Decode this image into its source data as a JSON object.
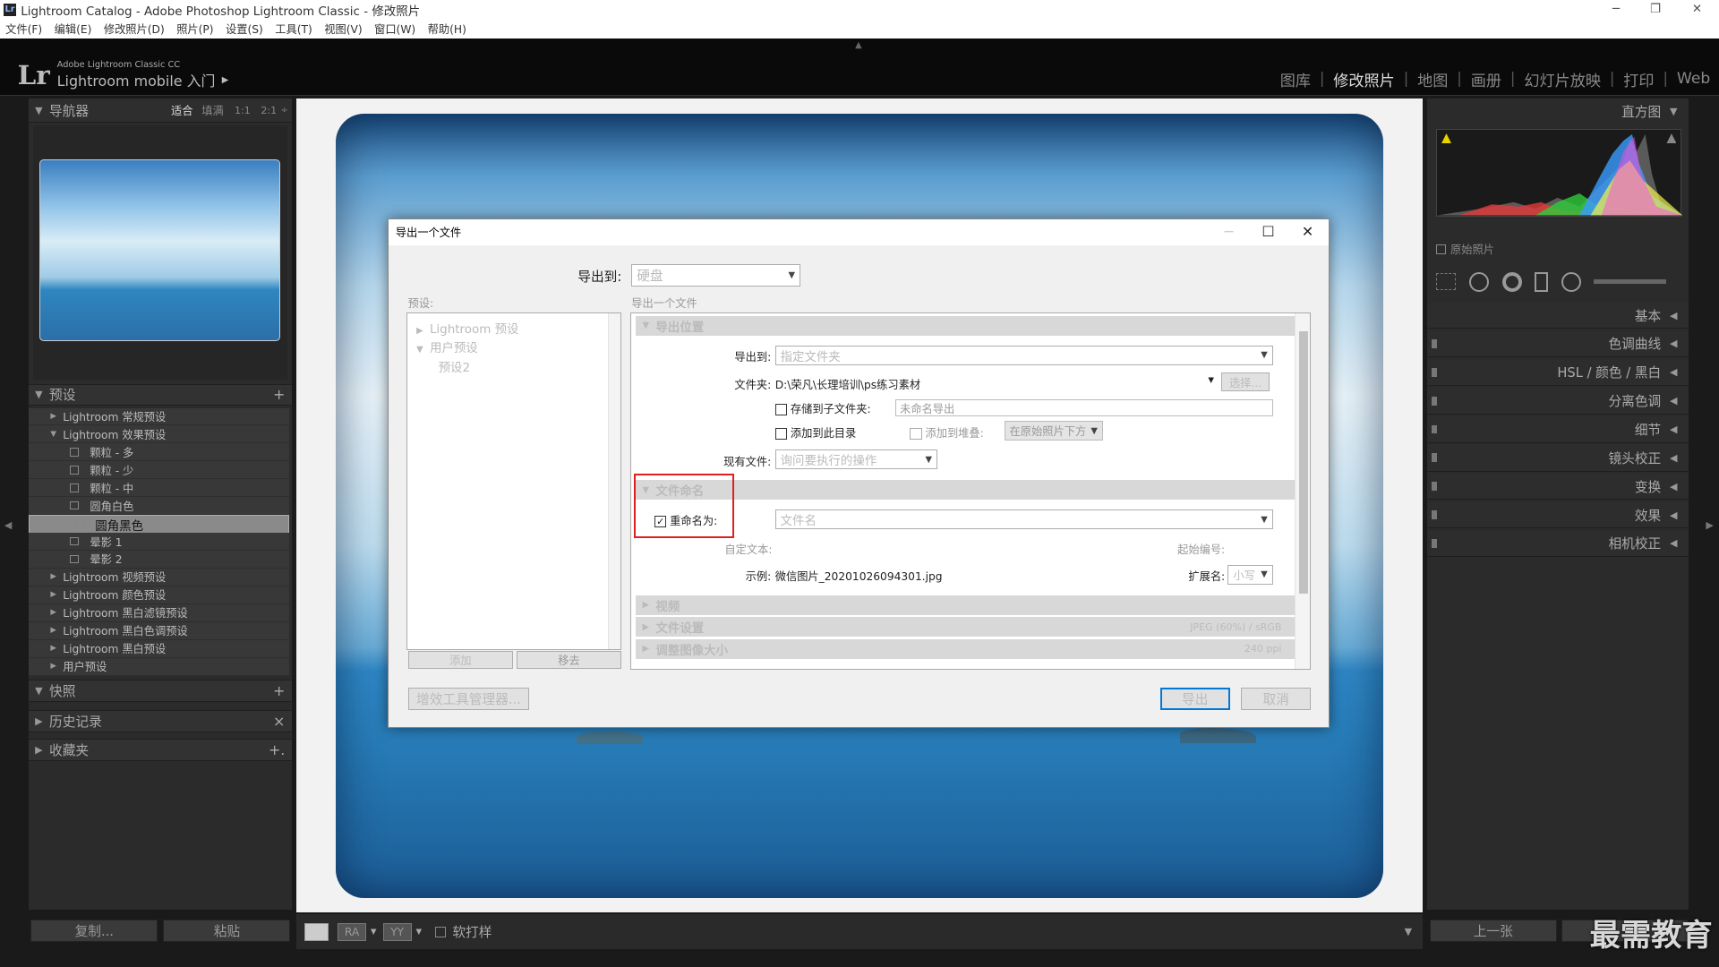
{
  "window": {
    "title": "Lightroom Catalog - Adobe Photoshop Lightroom Classic - 修改照片",
    "app_icon": "Lr",
    "controls": [
      "─",
      "❐",
      "✕"
    ]
  },
  "menu": [
    "文件(F)",
    "编辑(E)",
    "修改照片(D)",
    "照片(P)",
    "设置(S)",
    "工具(T)",
    "视图(V)",
    "窗口(W)",
    "帮助(H)"
  ],
  "identity": {
    "logo": "Lr",
    "product": "Adobe Lightroom Classic CC",
    "mobile": "Lightroom mobile 入门",
    "mobile_arrow": "▶"
  },
  "modules": [
    "图库",
    "修改照片",
    "地图",
    "画册",
    "幻灯片放映",
    "打印",
    "Web"
  ],
  "modules_active": "修改照片",
  "module_separator": "|",
  "navigator": {
    "title": "导航器",
    "zoom": [
      "适合",
      "填满",
      "1:1",
      "2:1"
    ],
    "zoom_more": "÷"
  },
  "presets": {
    "title": "预设",
    "items": [
      {
        "label": "Lightroom 常规预设",
        "type": "folder",
        "open": false
      },
      {
        "label": "Lightroom 效果预设",
        "type": "folder",
        "open": true
      },
      {
        "label": "颗粒 - 多",
        "type": "item"
      },
      {
        "label": "颗粒 - 少",
        "type": "item"
      },
      {
        "label": "颗粒 - 中",
        "type": "item"
      },
      {
        "label": "圆角白色",
        "type": "item"
      },
      {
        "label": "圆角黑色",
        "type": "item",
        "selected": true
      },
      {
        "label": "晕影 1",
        "type": "item"
      },
      {
        "label": "晕影 2",
        "type": "item"
      },
      {
        "label": "Lightroom 视频预设",
        "type": "folder",
        "open": false
      },
      {
        "label": "Lightroom 颜色预设",
        "type": "folder",
        "open": false
      },
      {
        "label": "Lightroom 黑白滤镜预设",
        "type": "folder",
        "open": false
      },
      {
        "label": "Lightroom 黑白色调预设",
        "type": "folder",
        "open": false
      },
      {
        "label": "Lightroom 黑白预设",
        "type": "folder",
        "open": false
      },
      {
        "label": "用户预设",
        "type": "folder",
        "open": false
      }
    ]
  },
  "left_sections": [
    {
      "title": "快照",
      "action": "+"
    },
    {
      "title": "历史记录",
      "action": "×"
    },
    {
      "title": "收藏夹",
      "action": "+."
    }
  ],
  "left_buttons": {
    "copy": "复制...",
    "paste": "粘贴"
  },
  "toolbar": {
    "softproof": "软打样",
    "views": [
      "▭",
      "RA",
      "YY"
    ]
  },
  "right_panel": {
    "histogram_title": "直方图",
    "original_photo": "原始照片",
    "sections": [
      "基本",
      "色调曲线",
      "HSL / 颜色 / 黑白",
      "分离色调",
      "细节",
      "镜头校正",
      "变换",
      "效果",
      "相机校正"
    ],
    "prev": "上一张",
    "watermark": "最需教育"
  },
  "dialog": {
    "title": "导出一个文件",
    "export_to_label": "导出到:",
    "export_to_value": "硬盘",
    "preset_label": "预设:",
    "right_label": "导出一个文件",
    "preset_tree": [
      {
        "label": "Lightroom 预设",
        "tri": "▶"
      },
      {
        "label": "用户预设",
        "tri": "▼"
      },
      {
        "label": "预设2",
        "tri": ""
      }
    ],
    "add": "添加",
    "remove": "移去",
    "plugin_manager": "增效工具管理器...",
    "export": "导出",
    "cancel": "取消",
    "location": {
      "title": "导出位置",
      "export_to_label": "导出到:",
      "export_to_value": "指定文件夹",
      "folder_label": "文件夹:",
      "folder_value": "D:\\荣凡\\长理培训\\ps练习素材",
      "choose": "选择...",
      "subfolder_label": "存储到子文件夹:",
      "subfolder_placeholder": "未命名导出",
      "add_catalog": "添加到此目录",
      "add_stack": "添加到堆叠:",
      "stack_value": "在原始照片下方",
      "existing_label": "现有文件:",
      "existing_value": "询问要执行的操作"
    },
    "naming": {
      "title": "文件命名",
      "rename_label": "重命名为:",
      "rename_checked": true,
      "rename_value": "文件名",
      "custom_text": "自定文本:",
      "start_number": "起始编号:",
      "example_label": "示例:",
      "example_value": "微信图片_20201026094301.jpg",
      "ext_label": "扩展名:",
      "ext_value": "小写"
    },
    "collapsed": [
      {
        "title": "视频",
        "value": ""
      },
      {
        "title": "文件设置",
        "value": "JPEG (60%) / sRGB"
      },
      {
        "title": "调整图像大小",
        "value": "240 ppi"
      }
    ]
  }
}
